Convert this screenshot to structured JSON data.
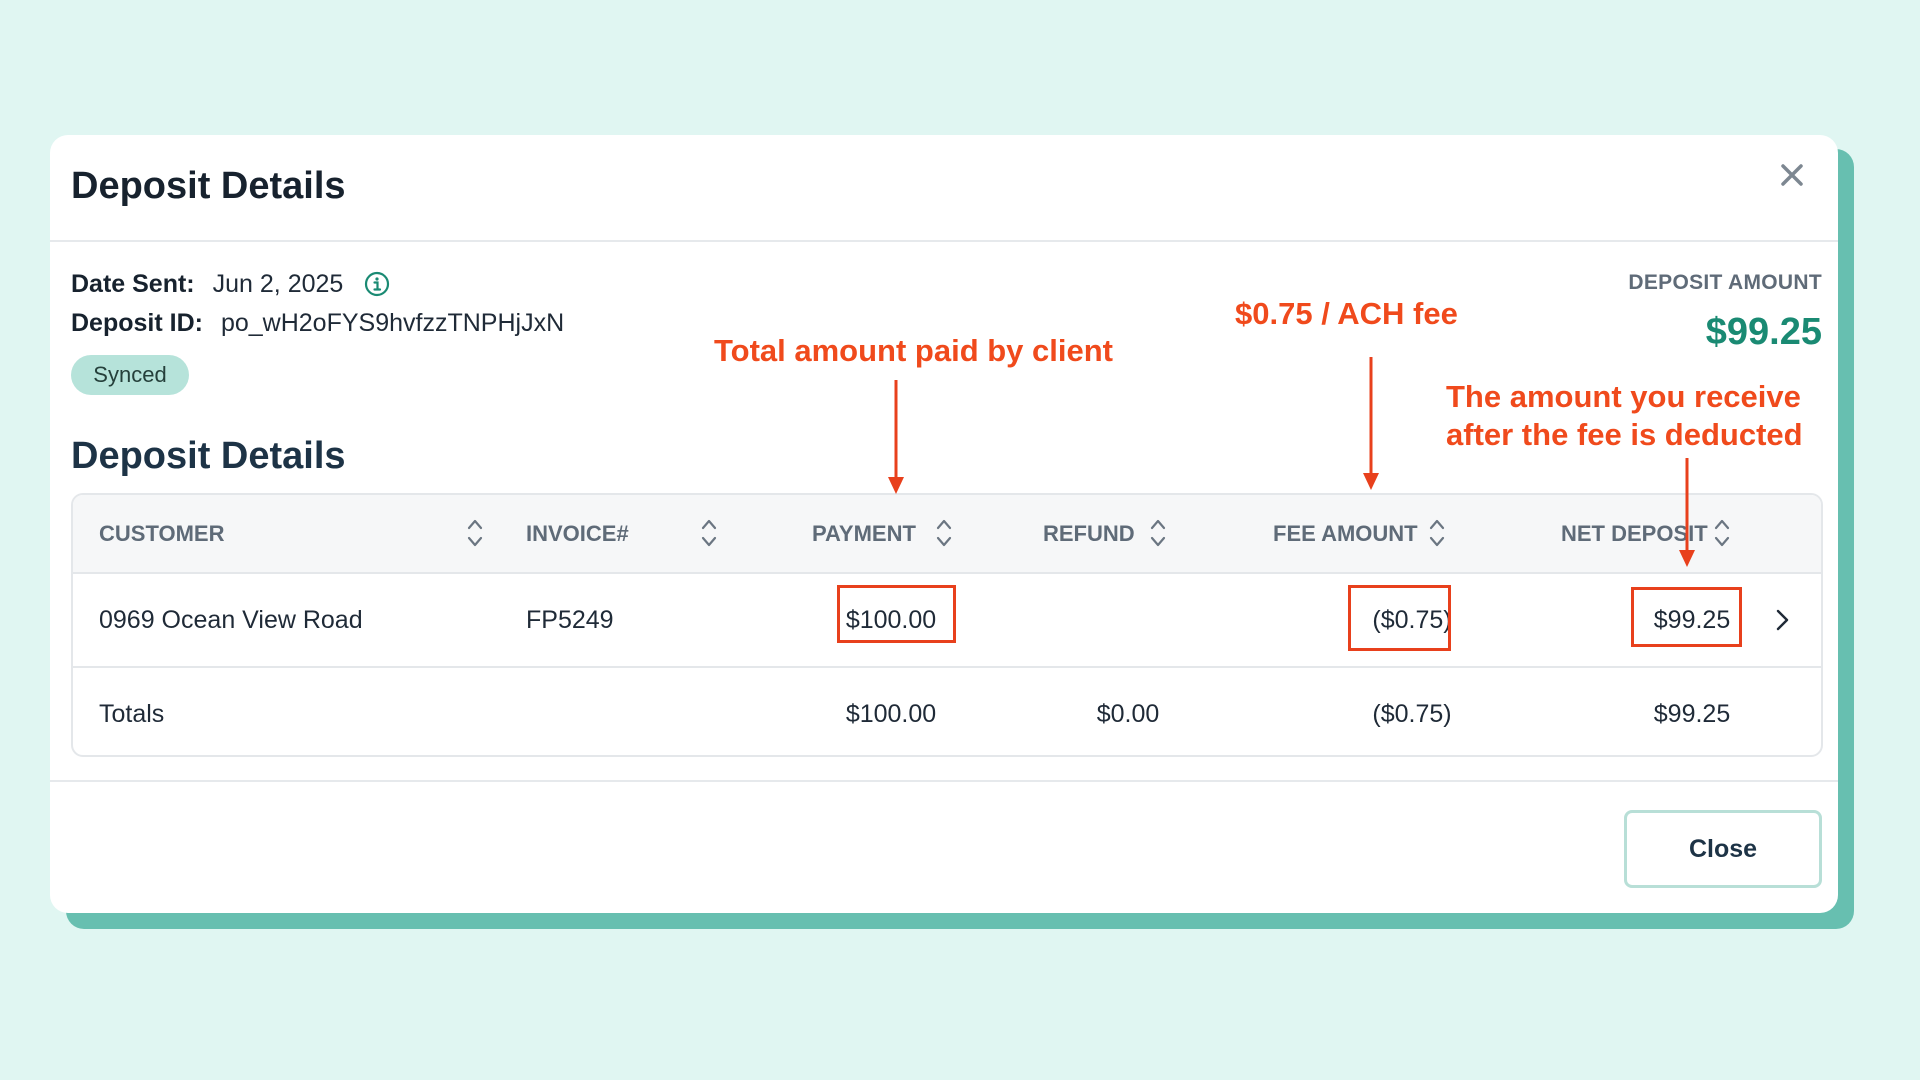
{
  "modal": {
    "title": "Deposit Details",
    "close_icon": "close-icon"
  },
  "meta": {
    "date_label": "Date Sent:",
    "date_value": "Jun 2, 2025",
    "deposit_id_label": "Deposit ID:",
    "deposit_id_value": "po_wH2oFYS9hvfzzTNPHjJxN",
    "status_badge": "Synced"
  },
  "deposit_amount": {
    "label": "DEPOSIT AMOUNT",
    "value": "$99.25"
  },
  "section_title": "Deposit Details",
  "table": {
    "columns": [
      "CUSTOMER",
      "INVOICE#",
      "PAYMENT",
      "REFUND",
      "FEE AMOUNT",
      "NET DEPOSIT"
    ],
    "rows": [
      {
        "customer": "0969 Ocean View Road",
        "invoice": "FP5249",
        "payment": "$100.00",
        "refund": "",
        "fee": "($0.75)",
        "net": "$99.25"
      }
    ],
    "totals": {
      "label": "Totals",
      "payment": "$100.00",
      "refund": "$0.00",
      "fee": "($0.75)",
      "net": "$99.25"
    }
  },
  "footer": {
    "close_label": "Close"
  },
  "annotations": {
    "payment_note": "Total amount paid by client",
    "fee_note": "$0.75 / ACH fee",
    "net_note_line1": "The amount you receive",
    "net_note_line2": "after the fee is deducted"
  },
  "colors": {
    "background": "#e0f6f2",
    "accent_green": "#1a8a73",
    "annotation_red": "#f04a1c",
    "badge_bg": "#b6e3da"
  }
}
